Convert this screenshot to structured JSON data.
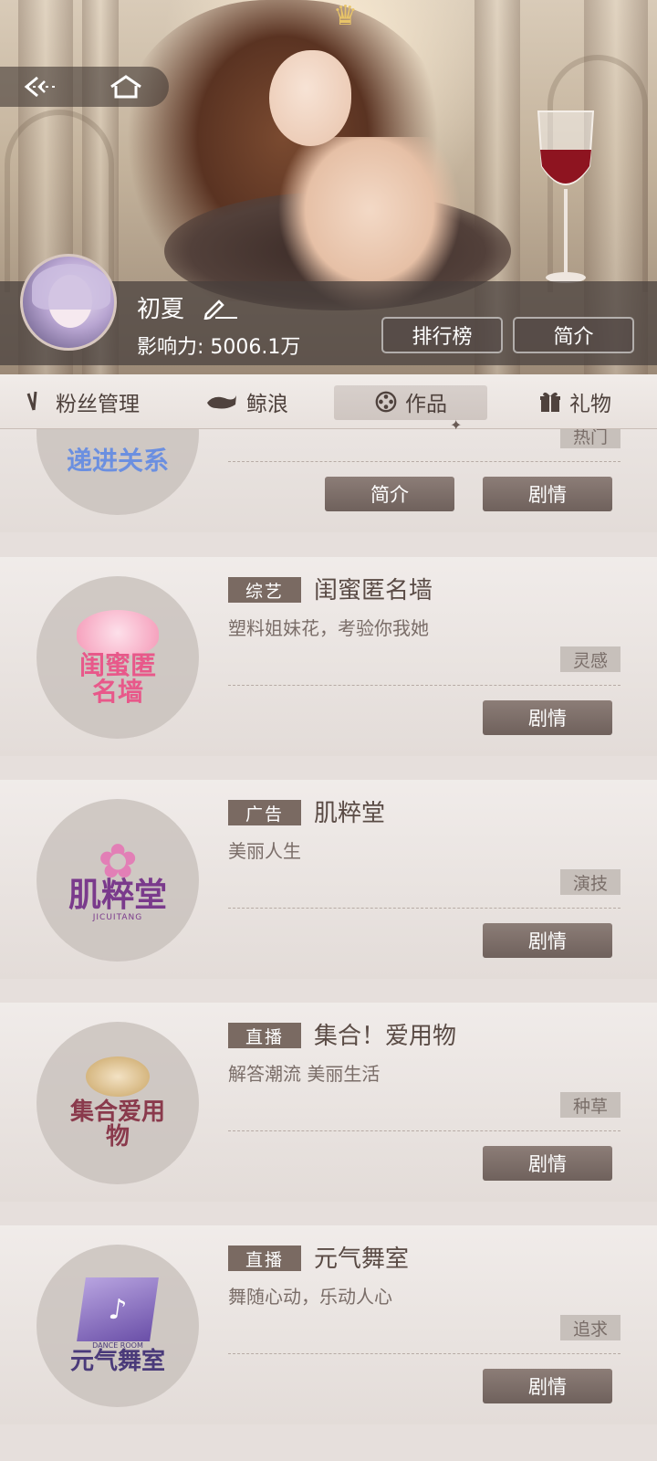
{
  "hero": {
    "nav": {
      "back_icon": "back-arrow-icon",
      "home_icon": "home-icon"
    },
    "profile": {
      "name": "初夏",
      "influence_label": "影响力: ",
      "influence_value": "5006.1万",
      "ranking_button": "排行榜",
      "intro_button": "简介"
    }
  },
  "tabs": [
    {
      "label": "粉丝管理",
      "icon": "fan-icon"
    },
    {
      "label": "鲸浪",
      "icon": "whale-icon"
    },
    {
      "label": "作品",
      "icon": "film-reel-icon",
      "active": true
    },
    {
      "label": "礼物",
      "icon": "gift-icon"
    }
  ],
  "works": [
    {
      "logo_text": "递进关系",
      "attribute": "热门",
      "buttons": [
        "简介",
        "剧情"
      ]
    },
    {
      "tag": "综艺",
      "title": "闺蜜匿名墙",
      "subtitle": "塑料姐妹花，考验你我她",
      "logo_text": "闺蜜匿名墙",
      "attribute": "灵感",
      "buttons": [
        "剧情"
      ]
    },
    {
      "tag": "广告",
      "title": "肌粹堂",
      "subtitle": "美丽人生",
      "logo_text": "肌粹堂",
      "logo_sub": "JICUITANG",
      "attribute": "演技",
      "buttons": [
        "剧情"
      ]
    },
    {
      "tag": "直播",
      "title": "集合！爱用物",
      "subtitle": "解答潮流 美丽生活",
      "logo_text": "集合爱用物",
      "attribute": "种草",
      "buttons": [
        "剧情"
      ]
    },
    {
      "tag": "直播",
      "title": "元气舞室",
      "subtitle": "舞随心动，乐动人心",
      "logo_text": "元气舞室",
      "logo_sub": "DANCE ROOM",
      "attribute": "追求",
      "buttons": [
        "剧情"
      ]
    }
  ],
  "colors": {
    "tag_bg": "#7a6a62",
    "button_bg": "#7b6c66",
    "accent": "#4f423d"
  }
}
